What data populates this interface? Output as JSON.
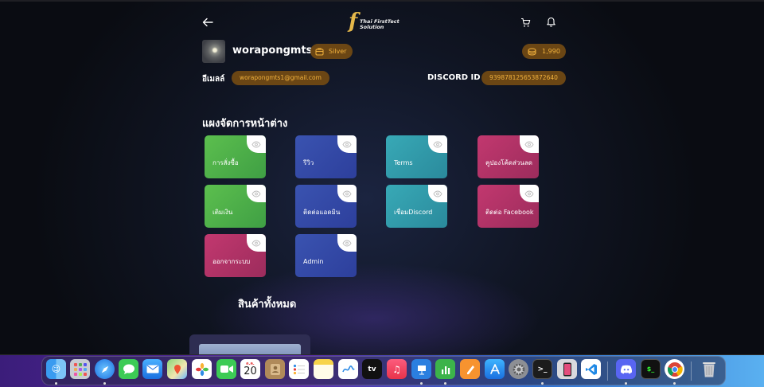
{
  "header": {
    "back_label": "back",
    "logo_letter": "f",
    "logo_text_line1": "Thai FirstTect",
    "logo_text_line2": "Solution"
  },
  "profile": {
    "username": "worapongmts1",
    "tier": "Silver",
    "coins": "1,990",
    "email_label": "อีเมลล์",
    "email": "worapongmts1@gmail.com",
    "discord_label": "DISCORD ID",
    "discord_id": "939878125653872640"
  },
  "dashboard": {
    "title": "แผงจัดการหน้าต่าง",
    "tiles": [
      {
        "label": "การสั่งซื้อ",
        "color": "green"
      },
      {
        "label": "รีวิว",
        "color": "blue"
      },
      {
        "label": "Terms",
        "color": "teal"
      },
      {
        "label": "คูปองโค้ดส่วนลด",
        "color": "pink"
      },
      {
        "label": "เติมเงิน",
        "color": "green"
      },
      {
        "label": "ติดต่อแอดมิน",
        "color": "blue"
      },
      {
        "label": "เชื่อมDiscord",
        "color": "teal"
      },
      {
        "label": "ติดต่อ Facebook",
        "color": "pink"
      },
      {
        "label": "ออกจากระบบ",
        "color": "pink"
      },
      {
        "label": "Admin",
        "color": "blue"
      }
    ]
  },
  "products": {
    "title": "สินค้าทั้งหมด"
  },
  "dock": {
    "calendar_month": "ต.ค.",
    "calendar_day": "20",
    "appletv_label": "tv",
    "items": [
      "finder-icon",
      "launchpad-icon",
      "safari-icon",
      "messages-icon",
      "mail-icon",
      "maps-icon",
      "photos-icon",
      "facetime-icon",
      "calendar-icon",
      "contacts-icon",
      "reminders-icon",
      "notes-icon",
      "freeform-icon",
      "appletv-icon",
      "music-icon",
      "keynote-icon",
      "numbers-icon",
      "pages-icon",
      "appstore-icon",
      "settings-icon",
      "terminal-icon",
      "iphone-mirroring-icon",
      "vscode-icon",
      "discord-icon",
      "terminal2-icon",
      "chrome-icon",
      "trash-icon"
    ]
  }
}
